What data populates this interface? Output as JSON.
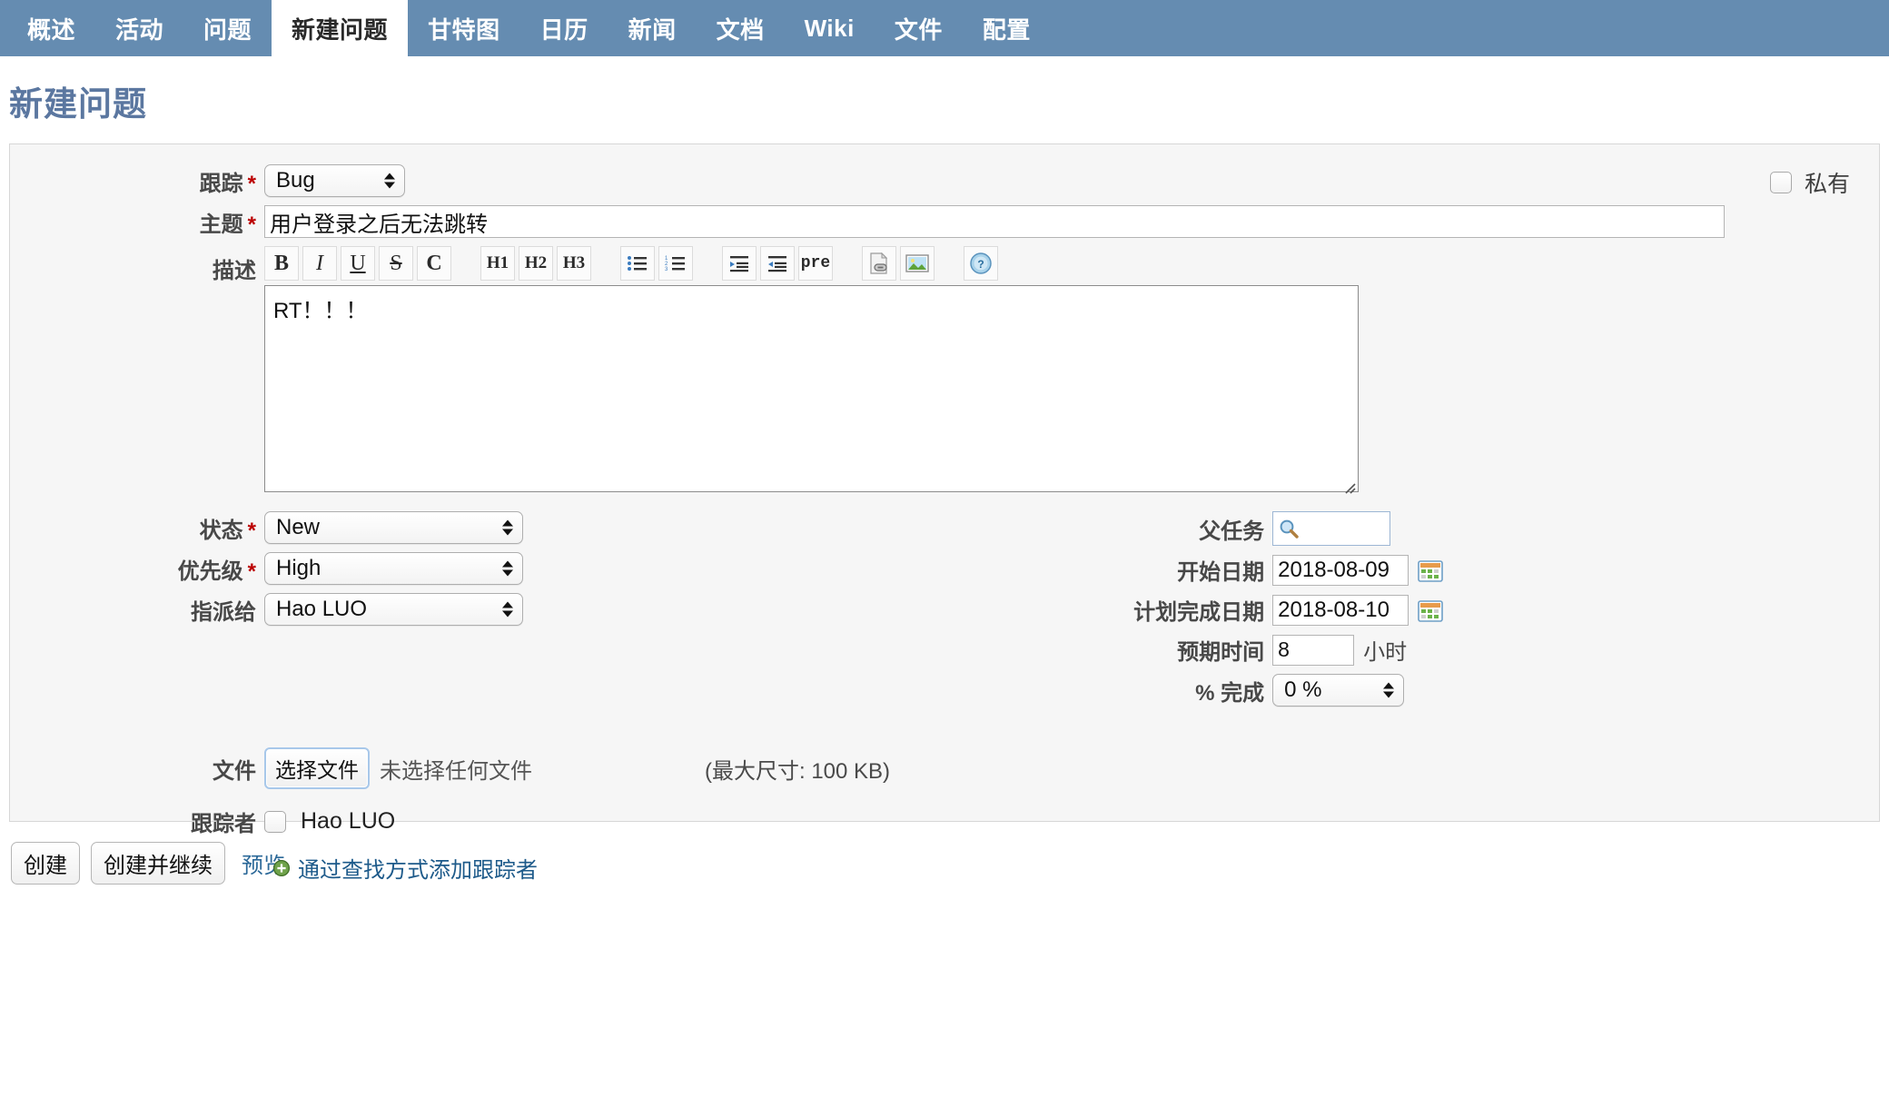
{
  "tabs": [
    {
      "label": "概述",
      "active": false
    },
    {
      "label": "活动",
      "active": false
    },
    {
      "label": "问题",
      "active": false
    },
    {
      "label": "新建问题",
      "active": true
    },
    {
      "label": "甘特图",
      "active": false
    },
    {
      "label": "日历",
      "active": false
    },
    {
      "label": "新闻",
      "active": false
    },
    {
      "label": "文档",
      "active": false
    },
    {
      "label": "Wiki",
      "active": false
    },
    {
      "label": "文件",
      "active": false
    },
    {
      "label": "配置",
      "active": false
    }
  ],
  "page": {
    "title": "新建问题",
    "header_color": "#658cb1",
    "title_color": "#5b77a0"
  },
  "form": {
    "tracker": {
      "label": "跟踪",
      "required": "*",
      "value": "Bug"
    },
    "subject": {
      "label": "主题",
      "required": "*",
      "value": "用户登录之后无法跳转"
    },
    "description": {
      "label": "描述",
      "value": "RT！！！"
    },
    "status": {
      "label": "状态",
      "required": "*",
      "value": "New"
    },
    "priority": {
      "label": "优先级",
      "required": "*",
      "value": "High"
    },
    "assignee": {
      "label": "指派给",
      "value": "Hao LUO"
    },
    "parent_task": {
      "label": "父任务",
      "value": "",
      "icon": "search-icon"
    },
    "start_date": {
      "label": "开始日期",
      "value": "2018-08-09"
    },
    "due_date": {
      "label": "计划完成日期",
      "value": "2018-08-10"
    },
    "estimated_time": {
      "label": "预期时间",
      "value": "8",
      "unit": "小时"
    },
    "done_ratio": {
      "label": "% 完成",
      "value": "0 %"
    },
    "private": {
      "label": "私有",
      "checked": false
    },
    "attachment": {
      "label": "文件",
      "button_label": "选择文件",
      "status": "未选择任何文件",
      "max_size_note": "(最大尺寸: 100 KB)"
    },
    "watchers": {
      "label": "跟踪者",
      "items": [
        {
          "name": "Hao LUO",
          "checked": false
        }
      ],
      "add_link": "通过查找方式添加跟踪者"
    }
  },
  "toolbar": {
    "buttons": [
      {
        "name": "bold-icon",
        "glyph": "B"
      },
      {
        "name": "italic-icon",
        "glyph": "I"
      },
      {
        "name": "underline-icon",
        "glyph": "U"
      },
      {
        "name": "strikethrough-icon",
        "glyph": "S"
      },
      {
        "name": "code-icon",
        "glyph": "C"
      },
      {
        "name": "heading1-icon",
        "glyph": "H1"
      },
      {
        "name": "heading2-icon",
        "glyph": "H2"
      },
      {
        "name": "heading3-icon",
        "glyph": "H3"
      },
      {
        "name": "unordered-list-icon",
        "glyph": ""
      },
      {
        "name": "ordered-list-icon",
        "glyph": ""
      },
      {
        "name": "indent-right-icon",
        "glyph": ""
      },
      {
        "name": "indent-left-icon",
        "glyph": ""
      },
      {
        "name": "preformatted-icon",
        "glyph": "pre"
      },
      {
        "name": "link-page-icon",
        "glyph": ""
      },
      {
        "name": "image-icon",
        "glyph": ""
      },
      {
        "name": "help-icon",
        "glyph": "?"
      }
    ]
  },
  "actions": {
    "create": "创建",
    "create_and_continue": "创建并继续",
    "preview": "预览"
  }
}
